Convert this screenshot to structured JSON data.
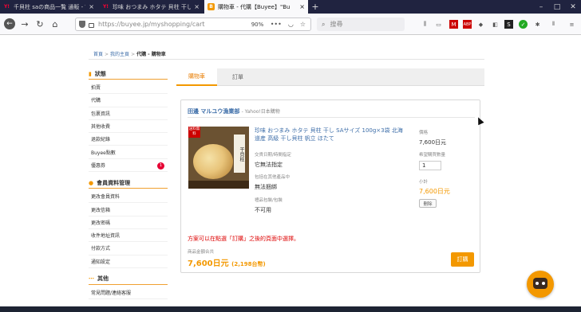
{
  "tabs": [
    {
      "title": "千貝柱 saの商品一覧 通販 - Ya",
      "icon": "yahoo-icon"
    },
    {
      "title": "珍味 おつまみ ホタテ 貝柱 干し",
      "icon": "yahoo-icon"
    },
    {
      "title": "購物車 - 代購【Buyee】\"Bu",
      "icon": "buyee-icon"
    }
  ],
  "address_bar": {
    "url": "https://buyee.jp/myshopping/cart",
    "zoom": "90%"
  },
  "search_bar": {
    "placeholder": "搜尋"
  },
  "breadcrumb": {
    "home": "首頁",
    "mypage": "我的主頁",
    "current": "代購 - 購物車"
  },
  "sidebar": {
    "group1_title": "狀態",
    "group1_items": [
      "拍賣",
      "代購",
      "包裹資訊",
      "其他收費",
      "退款紀錄",
      "Buyee點數",
      "優惠券"
    ],
    "coupon_badge": "1",
    "group2_title": "會員資料管理",
    "group2_items": [
      "更改會員資料",
      "更改信箱",
      "更改密碼",
      "收件地址資訊",
      "付款方式",
      "通知設定"
    ],
    "group3_title": "其他",
    "group3_items": [
      "常見問題/連絡客服"
    ]
  },
  "page_tabs": {
    "cart": "購物車",
    "order": "訂單"
  },
  "cart": {
    "store_name": "田邊 マルユウ漁業部",
    "store_source": "- Yahoo!日本購物",
    "product_tag": "送料無料",
    "product_label": "干貝柱",
    "product_title": "珍味 おつまみ ホタテ 貝柱 干し SAサイズ 100g×3袋 北海道産 高級 干し貝柱 帆立 ほたて",
    "opt1_label": "交貨日期/時間指定",
    "opt1_value": "它無法指定",
    "opt2_label": "包括在其他產品中",
    "opt2_value": "無法捆綁",
    "opt3_label": "禮品包裝/包裝",
    "opt3_value": "不可用",
    "price_label": "價格",
    "price": "7,600日元",
    "qty_label": "希望購買數量",
    "qty": "1",
    "subtotal_label": "小計",
    "subtotal": "7,600日元",
    "delete": "刪除",
    "notice": "方案可以在點選「訂購」之後的頁面中選擇。",
    "total_label": "商品金額合共",
    "total": "7,600日元",
    "total_twd": "(2,198台幣)",
    "order_button": "訂購"
  }
}
